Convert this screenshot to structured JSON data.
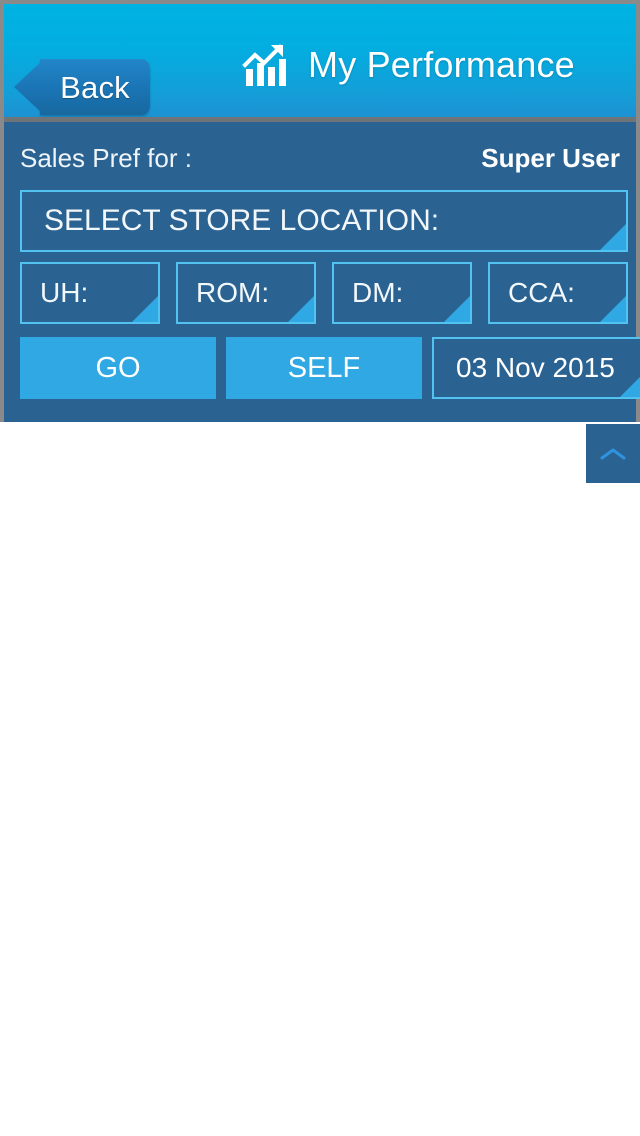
{
  "header": {
    "back_label": "Back",
    "title": "My Performance",
    "icon": "bar-chart-trend-up-icon"
  },
  "filters": {
    "pref_label": "Sales Pref for :",
    "user_name": "Super User",
    "store_location": {
      "value": "SELECT STORE LOCATION:",
      "icon": "dropdown-corner-icon"
    },
    "selectors": [
      {
        "id": "uh",
        "label": "UH:"
      },
      {
        "id": "rom",
        "label": "ROM:"
      },
      {
        "id": "dm",
        "label": "DM:"
      },
      {
        "id": "cca",
        "label": "CCA:"
      }
    ],
    "actions": {
      "go_label": "GO",
      "self_label": "SELF",
      "date_value": "03 Nov 2015"
    }
  },
  "collapse_tab": {
    "icon": "chevron-up-icon"
  },
  "colors": {
    "header_top": "#00b3e3",
    "header_bottom": "#1f8fd2",
    "panel_bg": "#2a6292",
    "accent_light_blue": "#2fa8e4",
    "field_border": "#52c2f0",
    "back_button": "#1a74b4",
    "text_white": "#ffffff",
    "content_bg": "#ffffff"
  }
}
